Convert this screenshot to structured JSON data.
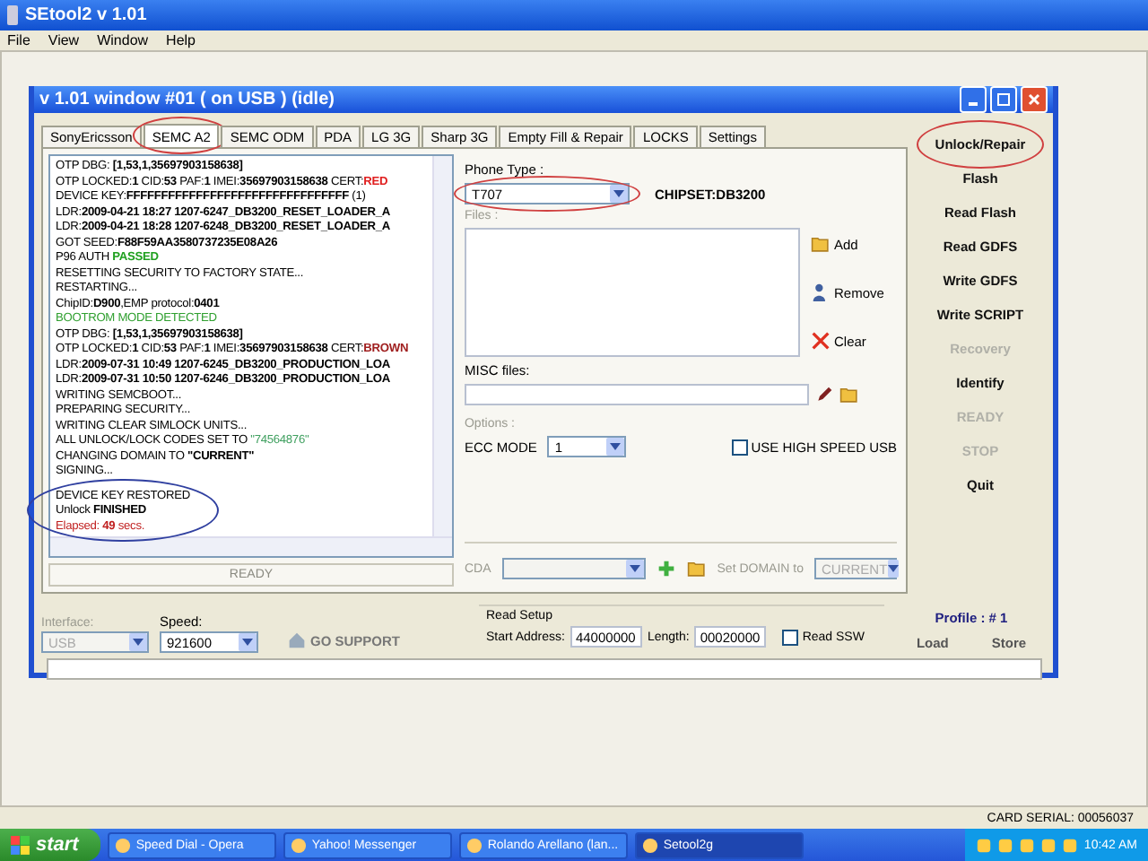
{
  "app_window": {
    "title": "SEtool2 v 1.01",
    "menu": [
      "File",
      "View",
      "Window",
      "Help"
    ]
  },
  "child_window": {
    "title": "v 1.01 window #01 ( on USB ) (idle)",
    "tabs": [
      {
        "label": "SonyEricsson",
        "selected": false,
        "circled": false
      },
      {
        "label": "SEMC A2",
        "selected": true,
        "circled": true
      },
      {
        "label": "SEMC ODM",
        "selected": false,
        "circled": false
      },
      {
        "label": "PDA",
        "selected": false,
        "circled": false
      },
      {
        "label": "LG 3G",
        "selected": false,
        "circled": false
      },
      {
        "label": "Sharp 3G",
        "selected": false,
        "circled": false
      },
      {
        "label": "Empty Fill & Repair",
        "selected": false,
        "circled": false
      },
      {
        "label": "LOCKS",
        "selected": false,
        "circled": false
      },
      {
        "label": "Settings",
        "selected": false,
        "circled": false
      }
    ],
    "log": {
      "lines": [
        {
          "segments": [
            {
              "text": "OTP DBG: "
            },
            {
              "text": "[1,53,1,35697903158638]",
              "bold": true
            }
          ]
        },
        {
          "segments": [
            {
              "text": "OTP LOCKED:"
            },
            {
              "text": "1",
              "bold": true
            },
            {
              "text": " CID:"
            },
            {
              "text": "53",
              "bold": true
            },
            {
              "text": " PAF:"
            },
            {
              "text": "1",
              "bold": true
            },
            {
              "text": " IMEI:"
            },
            {
              "text": "35697903158638",
              "bold": true
            },
            {
              "text": " CERT:"
            },
            {
              "text": "RED",
              "bold": true,
              "color": "#e02020"
            }
          ]
        },
        {
          "segments": [
            {
              "text": "DEVICE KEY:"
            },
            {
              "text": "FFFFFFFFFFFFFFFFFFFFFFFFFFFFFFFF",
              "bold": true
            },
            {
              "text": " (1)"
            }
          ]
        },
        {
          "segments": [
            {
              "text": "LDR:"
            },
            {
              "text": "2009-04-21 18:27 1207-6247_DB3200_RESET_LOADER_A",
              "bold": true
            }
          ]
        },
        {
          "segments": [
            {
              "text": "LDR:"
            },
            {
              "text": "2009-04-21 18:28 1207-6248_DB3200_RESET_LOADER_A",
              "bold": true
            }
          ]
        },
        {
          "segments": [
            {
              "text": "GOT SEED:"
            },
            {
              "text": "F88F59AA3580737235E08A26",
              "bold": true
            }
          ]
        },
        {
          "segments": [
            {
              "text": "P96 AUTH "
            },
            {
              "text": "PASSED",
              "bold": true,
              "color": "#20a020"
            }
          ]
        },
        {
          "segments": [
            {
              "text": "RESETTING SECURITY TO FACTORY STATE..."
            }
          ]
        },
        {
          "segments": [
            {
              "text": "RESTARTING..."
            }
          ]
        },
        {
          "segments": [
            {
              "text": "ChipID:"
            },
            {
              "text": "D900",
              "bold": true
            },
            {
              "text": ",EMP protocol:"
            },
            {
              "text": "0401",
              "bold": true
            }
          ]
        },
        {
          "segments": [
            {
              "text": "BOOTROM MODE DETECTED",
              "color": "#30a030"
            }
          ]
        },
        {
          "segments": [
            {
              "text": "OTP DBG: "
            },
            {
              "text": "[1,53,1,35697903158638]",
              "bold": true
            }
          ]
        },
        {
          "segments": [
            {
              "text": "OTP LOCKED:"
            },
            {
              "text": "1",
              "bold": true
            },
            {
              "text": " CID:"
            },
            {
              "text": "53",
              "bold": true
            },
            {
              "text": " PAF:"
            },
            {
              "text": "1",
              "bold": true
            },
            {
              "text": " IMEI:"
            },
            {
              "text": "35697903158638",
              "bold": true
            },
            {
              "text": " CERT:"
            },
            {
              "text": "BROWN",
              "bold": true,
              "color": "#a02020"
            }
          ]
        },
        {
          "segments": [
            {
              "text": "LDR:"
            },
            {
              "text": "2009-07-31 10:49 1207-6245_DB3200_PRODUCTION_LOA",
              "bold": true
            }
          ]
        },
        {
          "segments": [
            {
              "text": "LDR:"
            },
            {
              "text": "2009-07-31 10:50 1207-6246_DB3200_PRODUCTION_LOA",
              "bold": true
            }
          ]
        },
        {
          "segments": [
            {
              "text": "WRITING SEMCBOOT..."
            }
          ]
        },
        {
          "segments": [
            {
              "text": "PREPARING SECURITY..."
            }
          ]
        },
        {
          "segments": [
            {
              "text": "WRITING CLEAR SIMLOCK UNITS..."
            }
          ]
        },
        {
          "segments": [
            {
              "text": "ALL UNLOCK/LOCK CODES SET TO "
            },
            {
              "text": "\"74564876\"",
              "color": "#40a060"
            }
          ]
        },
        {
          "segments": [
            {
              "text": "CHANGING DOMAIN TO "
            },
            {
              "text": "\"CURRENT\"",
              "bold": true
            }
          ]
        },
        {
          "segments": [
            {
              "text": "SIGNING..."
            }
          ]
        }
      ],
      "circled": {
        "color": "#3040a0",
        "lines": [
          {
            "segments": [
              {
                "text": "DEVICE KEY RESTORED"
              }
            ]
          },
          {
            "segments": [
              {
                "text": "Unlock "
              },
              {
                "text": "FINISHED",
                "bold": true
              }
            ]
          },
          {
            "segments": [
              {
                "text": "Elapsed: ",
                "color": "#c02020"
              },
              {
                "text": "49",
                "bold": true,
                "color": "#c02020"
              },
              {
                "text": " secs.",
                "color": "#c02020"
              }
            ]
          }
        ]
      },
      "status": "READY"
    },
    "phone_type": {
      "label": "Phone Type :",
      "value": "T707",
      "circled": true
    },
    "chipset": "CHIPSET:DB3200",
    "files": {
      "label": "Files :",
      "buttons": [
        {
          "label": "Add",
          "kind": "folder"
        },
        {
          "label": "Remove",
          "kind": "person"
        },
        {
          "label": "Clear",
          "kind": "cross"
        }
      ]
    },
    "misc_files": {
      "label": "MISC files:"
    },
    "options": {
      "label": "Options :",
      "ecc_label": "ECC MODE",
      "ecc_value": "1",
      "high_speed_usb": {
        "label": "USE HIGH SPEED USB",
        "checked": false
      }
    },
    "cda": {
      "label": "CDA",
      "domain_label": "Set DOMAIN to",
      "domain_value": "CURRENT"
    },
    "actions": [
      {
        "label": "Unlock/Repair",
        "disabled": false,
        "circled": true
      },
      {
        "label": "Flash",
        "disabled": false,
        "circled": false
      },
      {
        "label": "Read Flash",
        "disabled": false,
        "circled": false
      },
      {
        "label": "Read GDFS",
        "disabled": false,
        "circled": false
      },
      {
        "label": "Write GDFS",
        "disabled": false,
        "circled": false
      },
      {
        "label": "Write SCRIPT",
        "disabled": false,
        "circled": false
      },
      {
        "label": "Recovery",
        "disabled": true,
        "circled": false
      },
      {
        "label": "Identify",
        "disabled": false,
        "circled": false
      },
      {
        "label": "READY",
        "disabled": true,
        "circled": false
      },
      {
        "label": "STOP",
        "disabled": true,
        "circled": false
      },
      {
        "label": "Quit",
        "disabled": false,
        "circled": false
      }
    ],
    "interface": {
      "label": "Interface:",
      "value": "USB",
      "disabled": true
    },
    "speed": {
      "label": "Speed:",
      "value": "921600",
      "disabled": false
    },
    "go_support": "GO SUPPORT",
    "read_setup": {
      "label": "Read Setup",
      "start_label": "Start Address:",
      "start_value": "44000000",
      "length_label": "Length:",
      "length_value": "00020000",
      "read_ssw": {
        "label": "Read SSW",
        "checked": false
      }
    },
    "profile": {
      "label": "Profile : # 1",
      "buttons": [
        "Load",
        "Store"
      ]
    },
    "progress": {
      "level": 0
    }
  },
  "status_bar": "CARD SERIAL: 00056037",
  "taskbar": {
    "start": "start",
    "items": [
      {
        "label": "Speed Dial - Opera",
        "selected": false
      },
      {
        "label": "Yahoo! Messenger",
        "selected": false
      },
      {
        "label": "Rolando Arellano (lan...",
        "selected": false
      },
      {
        "label": "Setool2g",
        "selected": true
      }
    ],
    "clock": "10:42 AM"
  }
}
